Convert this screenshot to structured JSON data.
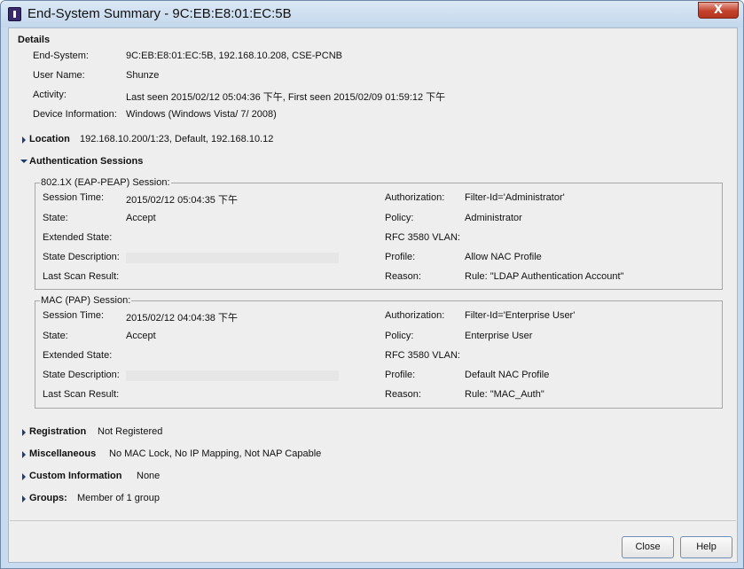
{
  "window": {
    "title": "End-System Summary - 9C:EB:E8:01:EC:5B",
    "close_glyph": "X"
  },
  "details": {
    "heading": "Details",
    "rows": [
      {
        "label": "End-System:",
        "value": "9C:EB:E8:01:EC:5B, 192.168.10.208, CSE-PCNB"
      },
      {
        "label": "User Name:",
        "value": "Shunze"
      },
      {
        "label": "Activity:",
        "value": "Last seen 2015/02/12 05:04:36 下午, First seen 2015/02/09 01:59:12 下午"
      },
      {
        "label": "Device Information:",
        "value": "Windows (Windows Vista/ 7/ 2008)"
      }
    ]
  },
  "location": {
    "label": "Location",
    "value": "192.168.10.200/1:23, Default, 192.168.10.12"
  },
  "auth": {
    "heading": "Authentication Sessions",
    "sessions": [
      {
        "title": "802.1X (EAP-PEAP) Session:",
        "left": [
          {
            "label": "Session Time:",
            "value": "2015/02/12 05:04:35 下午"
          },
          {
            "label": "State:",
            "value": "Accept"
          },
          {
            "label": "Extended State:",
            "value": ""
          },
          {
            "label": "State Description:",
            "value": ""
          },
          {
            "label": "Last Scan Result:",
            "value": ""
          }
        ],
        "right": [
          {
            "label": "Authorization:",
            "value": "Filter-Id='Administrator'"
          },
          {
            "label": "Policy:",
            "value": "Administrator"
          },
          {
            "label": "RFC 3580 VLAN:",
            "value": ""
          },
          {
            "label": "Profile:",
            "value": "Allow NAC Profile"
          },
          {
            "label": "Reason:",
            "value": "Rule: \"LDAP Authentication Account\""
          }
        ]
      },
      {
        "title": "MAC (PAP) Session:",
        "left": [
          {
            "label": "Session Time:",
            "value": "2015/02/12 04:04:38 下午"
          },
          {
            "label": "State:",
            "value": "Accept"
          },
          {
            "label": "Extended State:",
            "value": ""
          },
          {
            "label": "State Description:",
            "value": ""
          },
          {
            "label": "Last Scan Result:",
            "value": ""
          }
        ],
        "right": [
          {
            "label": "Authorization:",
            "value": "Filter-Id='Enterprise User'"
          },
          {
            "label": "Policy:",
            "value": "Enterprise User"
          },
          {
            "label": "RFC 3580 VLAN:",
            "value": ""
          },
          {
            "label": "Profile:",
            "value": "Default NAC Profile"
          },
          {
            "label": "Reason:",
            "value": "Rule: \"MAC_Auth\""
          }
        ]
      }
    ]
  },
  "registration": {
    "label": "Registration",
    "value": "Not Registered"
  },
  "miscellaneous": {
    "label": "Miscellaneous",
    "value": "No MAC Lock, No IP Mapping, Not NAP Capable"
  },
  "custom_info": {
    "label": "Custom Information",
    "value": "None"
  },
  "groups": {
    "label": "Groups:",
    "value": "Member of 1 group"
  },
  "buttons": {
    "close": "Close",
    "help": "Help"
  },
  "colors": {
    "expander": "#1a3c6e",
    "window_frame": "#c9dcef",
    "close_button": "#c4412c"
  }
}
